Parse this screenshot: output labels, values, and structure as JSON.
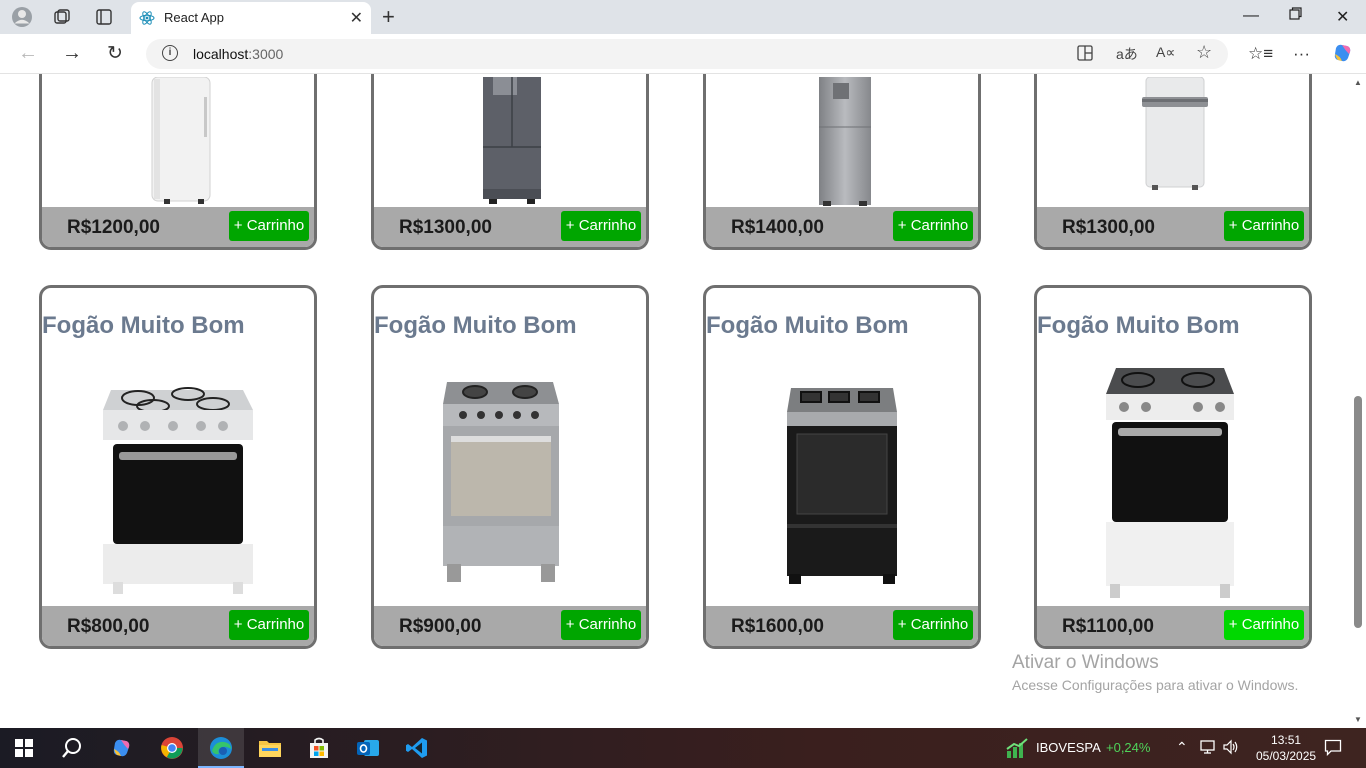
{
  "browser": {
    "tab_title": "React App",
    "url_host": "localhost",
    "url_port": ":3000"
  },
  "products_top": [
    {
      "price": "R$1200,00",
      "cart_label": "+ Carrinho"
    },
    {
      "price": "R$1300,00",
      "cart_label": "+ Carrinho"
    },
    {
      "price": "R$1400,00",
      "cart_label": "+ Carrinho"
    },
    {
      "price": "R$1300,00",
      "cart_label": "+ Carrinho"
    }
  ],
  "products_bottom": [
    {
      "title": "Fogão Muito Bom",
      "price": "R$800,00",
      "cart_label": "+ Carrinho"
    },
    {
      "title": "Fogão Muito Bom",
      "price": "R$900,00",
      "cart_label": "+ Carrinho"
    },
    {
      "title": "Fogão Muito Bom",
      "price": "R$1600,00",
      "cart_label": "+ Carrinho"
    },
    {
      "title": "Fogão Muito Bom",
      "price": "R$1100,00",
      "cart_label": "+ Carrinho"
    }
  ],
  "watermark": {
    "line1": "Ativar o Windows",
    "line2": "Acesse Configurações para ativar o Windows."
  },
  "taskbar": {
    "ticker_name": "IBOVESPA",
    "ticker_value": "+0,24%",
    "time": "13:51",
    "date": "05/03/2025"
  },
  "colors": {
    "cart_button": "#00a600",
    "cart_button_hover": "#00d800",
    "card_title": "#6b7a8f",
    "footer": "#a9a9a9"
  }
}
